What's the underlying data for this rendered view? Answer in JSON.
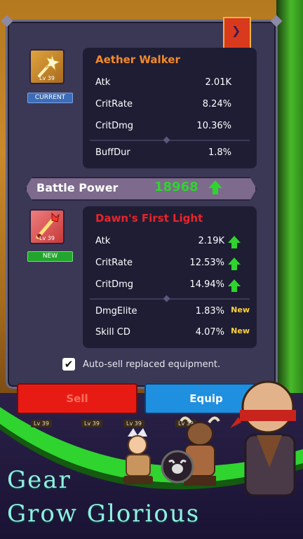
{
  "current_item": {
    "badge": "CURRENT",
    "level": "Lv 39",
    "name": "Aether Walker",
    "name_color": "#f28a2b",
    "stats": [
      {
        "label": "Atk",
        "value": "2.01K"
      },
      {
        "label": "CritRate",
        "value": "8.24%"
      },
      {
        "label": "CritDmg",
        "value": "10.36%"
      }
    ],
    "extra_stats": [
      {
        "label": "BuffDur",
        "value": "1.8%"
      }
    ]
  },
  "battle_power": {
    "label": "Battle Power",
    "value": "18968",
    "trend": "up"
  },
  "new_item": {
    "badge": "NEW",
    "level": "Lv 39",
    "name": "Dawn's First Light",
    "name_color": "#e8242a",
    "stats": [
      {
        "label": "Atk",
        "value": "2.19K",
        "trend": "up"
      },
      {
        "label": "CritRate",
        "value": "12.53%",
        "trend": "up"
      },
      {
        "label": "CritDmg",
        "value": "14.94%",
        "trend": "up"
      }
    ],
    "extra_stats": [
      {
        "label": "DmgElite",
        "value": "1.83%",
        "tag": "New"
      },
      {
        "label": "Skill CD",
        "value": "4.07%",
        "tag": "New"
      }
    ]
  },
  "auto_sell": {
    "label": "Auto-sell replaced equipment.",
    "checked": true
  },
  "buttons": {
    "sell": "Sell",
    "equip": "Equip"
  },
  "hero_levels": [
    "Lv 39",
    "Lv 39",
    "Lv 39",
    "Lv 39"
  ],
  "tagline": {
    "line1": "Gear",
    "line2": "Grow Glorious"
  },
  "colors": {
    "panel": "#1f1d34",
    "dialog": "#3b3856",
    "green_up": "#2fd42f",
    "sell_btn": "#e81b14",
    "equip_btn": "#1f8fe0",
    "new_tag": "#ffd23a"
  },
  "icons": {
    "ribbon": "chevron-down-icon",
    "trend": "arrow-up-icon",
    "checkbox": "checkmark-icon"
  }
}
